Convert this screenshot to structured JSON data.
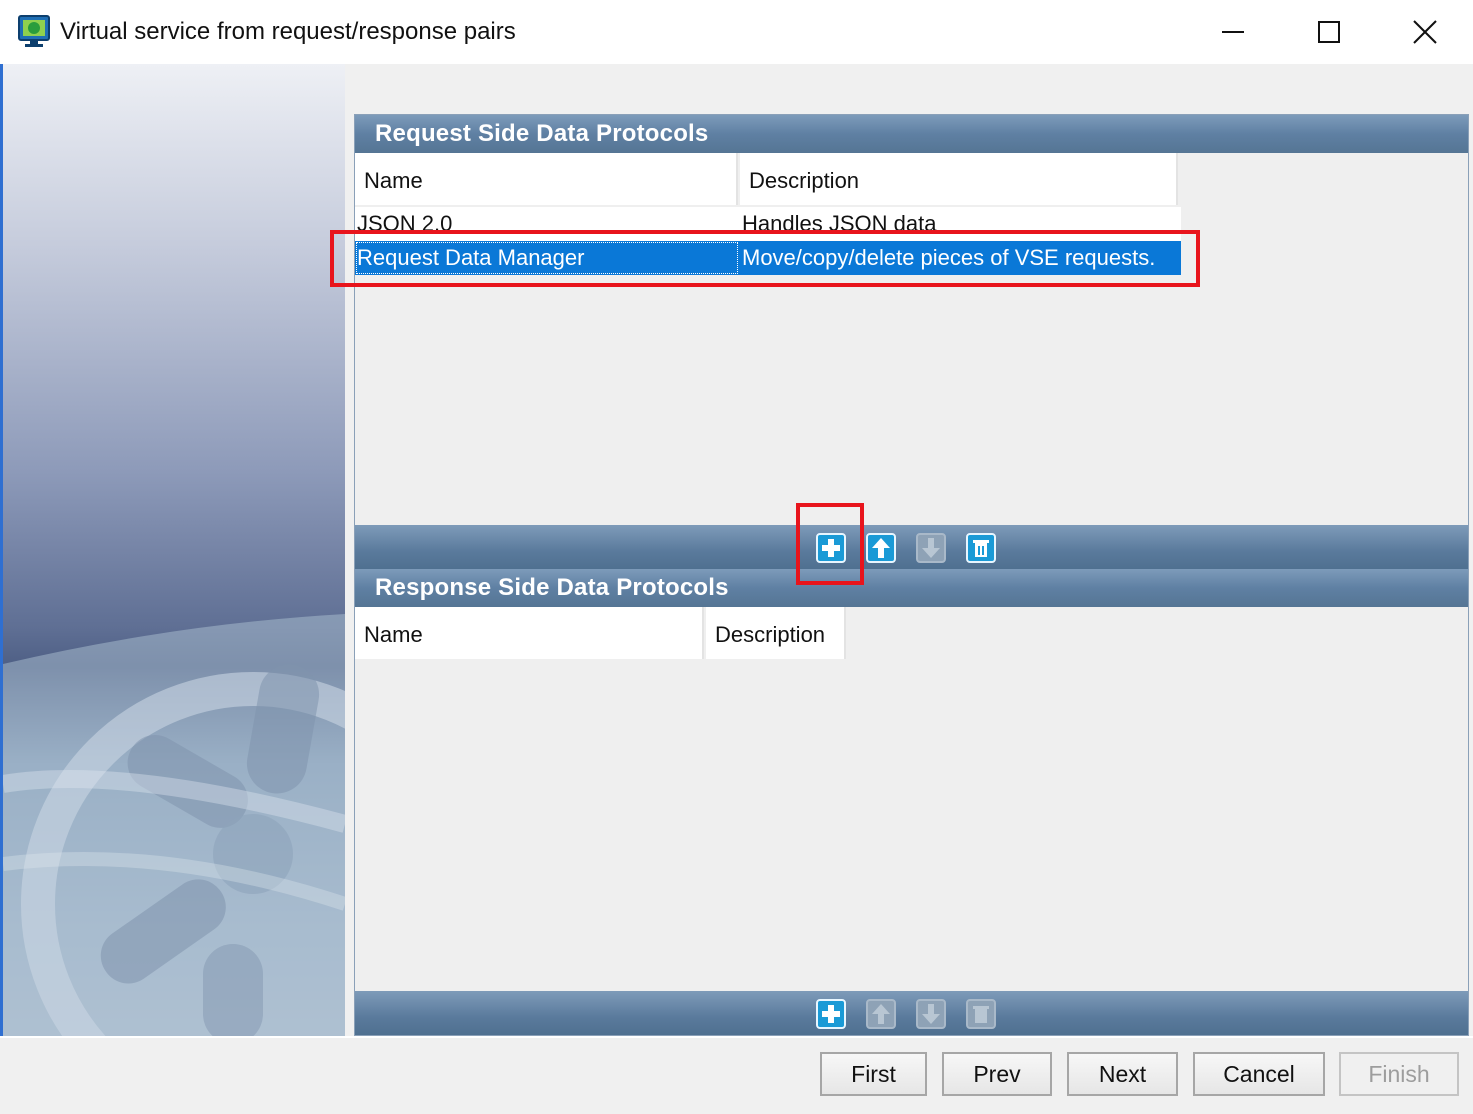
{
  "window": {
    "title": "Virtual service from request/response pairs",
    "controls": {
      "minimize": "minimize-icon",
      "maximize": "maximize-icon",
      "close": "close-icon"
    }
  },
  "request_panel": {
    "title": "Request Side Data Protocols",
    "columns": [
      "Name",
      "Description"
    ],
    "rows": [
      {
        "name": "JSON 2.0",
        "description": "Handles JSON data"
      },
      {
        "name": "Request Data Manager",
        "description": "Move/copy/delete pieces of VSE requests."
      }
    ],
    "selected_row": 1,
    "toolbar": [
      "add-icon",
      "move-up-icon",
      "move-down-icon",
      "delete-icon"
    ]
  },
  "response_panel": {
    "title": "Response Side Data Protocols",
    "columns": [
      "Name",
      "Description"
    ],
    "rows": [],
    "toolbar": [
      "add-icon",
      "move-up-icon",
      "move-down-icon",
      "delete-icon"
    ]
  },
  "footer": {
    "first": "First",
    "prev": "Prev",
    "next": "Next",
    "cancel": "Cancel",
    "finish": "Finish"
  },
  "colors": {
    "selection": "#0a78d7",
    "panel_header": "#5f80a3",
    "highlight": "#e8141c"
  }
}
